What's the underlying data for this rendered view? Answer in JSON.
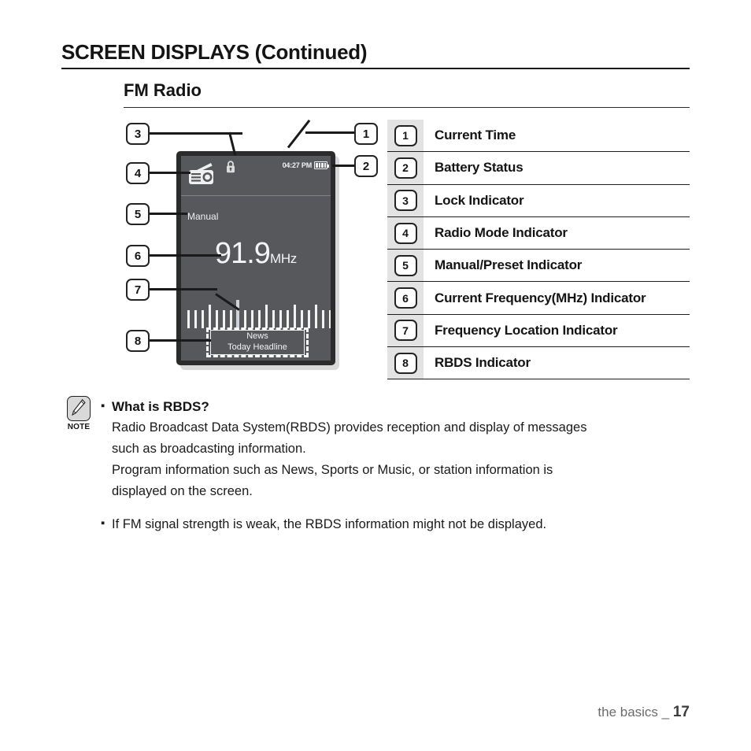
{
  "header": {
    "title": "SCREEN DISPLAYS (Continued)",
    "section": "FM Radio"
  },
  "device_screen": {
    "radio_icon": "radio-icon",
    "lock_icon": "lock-icon",
    "time": "04:27 PM",
    "battery_icon": "battery-icon",
    "battery_bars": 4,
    "mode": "Manual",
    "frequency": "91.9",
    "frequency_unit": "MHz",
    "rbds_line1": "News",
    "rbds_line2": "Today Headline",
    "screen_bg": "#56585c",
    "bezel_color": "#2b2b2b"
  },
  "callouts": [
    {
      "num": "1"
    },
    {
      "num": "2"
    },
    {
      "num": "3"
    },
    {
      "num": "4"
    },
    {
      "num": "5"
    },
    {
      "num": "6"
    },
    {
      "num": "7"
    },
    {
      "num": "8"
    }
  ],
  "legend": {
    "rows": [
      {
        "num": "1",
        "label": "Current Time"
      },
      {
        "num": "2",
        "label": "Battery Status"
      },
      {
        "num": "3",
        "label": "Lock Indicator"
      },
      {
        "num": "4",
        "label": "Radio Mode Indicator"
      },
      {
        "num": "5",
        "label": "Manual/Preset Indicator"
      },
      {
        "num": "6",
        "label": "Current Frequency(MHz) Indicator"
      },
      {
        "num": "7",
        "label": "Frequency Location Indicator"
      },
      {
        "num": "8",
        "label": "RBDS Indicator"
      }
    ]
  },
  "note": {
    "icon_label": "NOTE",
    "bullet": "▪",
    "heading": "What is RBDS?",
    "para_line1": "Radio Broadcast Data System(RBDS) provides reception and display of messages",
    "para_line2": "such as broadcasting information.",
    "para_line3": "Program information such as News, Sports or Music, or station information is",
    "para_line4": "displayed on the screen.",
    "second_bullet_text": "If FM signal strength is weak, the RBDS information might not be displayed."
  },
  "footer": {
    "label": "the basics _",
    "page": "17"
  }
}
